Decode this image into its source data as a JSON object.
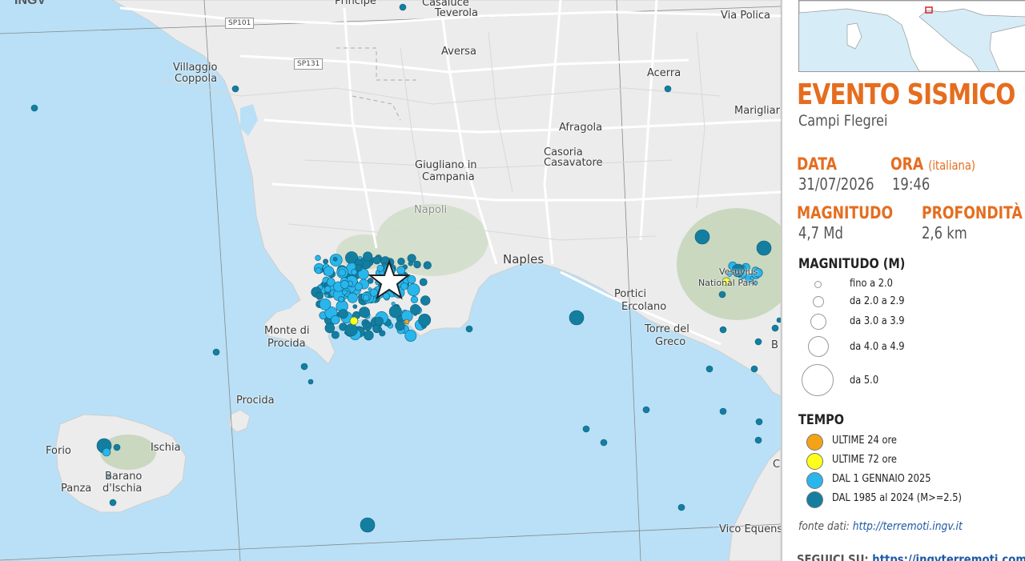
{
  "map": {
    "places": [
      "Principe",
      "Casaluce",
      "Teverola",
      "Via Polica",
      "Villaggio",
      "Coppola",
      "Aversa",
      "Acerra",
      "Marigliar",
      "Afragola",
      "Casoria",
      "Casavatore",
      "Giugliano in",
      "Campania",
      "Napoli",
      "Naples",
      "Portici",
      "Ercolano",
      "Torre del",
      "Greco",
      "Vesuvius",
      "National Park",
      "Monte di",
      "Procida",
      "Procida",
      "Forio",
      "Ischia",
      "Panza",
      "Barano",
      "d'Ischia",
      "Vico Equens",
      "B",
      "C"
    ],
    "roads": [
      "SP101",
      "SP131"
    ],
    "logo": "INGV",
    "epicenter_icon": "star-icon"
  },
  "panel": {
    "title": "EVENTO SISMICO",
    "subtitle": "Campi Flegrei",
    "data_label": "DATA",
    "data_value": "31/07/2026",
    "ora_label": "ORA",
    "ora_note": "(italiana)",
    "ora_value": "19:46",
    "magnitudo_label": "MAGNITUDO",
    "magnitudo_value": "4,7 Md",
    "profondita_label": "PROFONDITÀ",
    "profondita_value": "2,6 km",
    "legend_mag_title": "MAGNITUDO (M)",
    "legend_mag": [
      "fino a 2.0",
      "da 2.0 a 2.9",
      "da 3.0 a 3.9",
      "da 4.0 a 4.9",
      "da 5.0"
    ],
    "legend_time_title": "TEMPO",
    "legend_time": [
      {
        "label": "ULTIME 24 ore",
        "color": "#f5a316"
      },
      {
        "label": "ULTIME 72 ore",
        "color": "#ffff1a"
      },
      {
        "label": "DAL 1 GENNAIO 2025",
        "color": "#29b6ec"
      },
      {
        "label": "DAL 1985 al 2024 (M>=2.5)",
        "color": "#147ea0"
      }
    ],
    "fonte_prefix": "fonte dati:",
    "fonte_url": "http://terremoti.ingv.it",
    "seguici_prefix": "SEGUICI SU:",
    "seguici_url": "https://ingvterremoti.com"
  }
}
